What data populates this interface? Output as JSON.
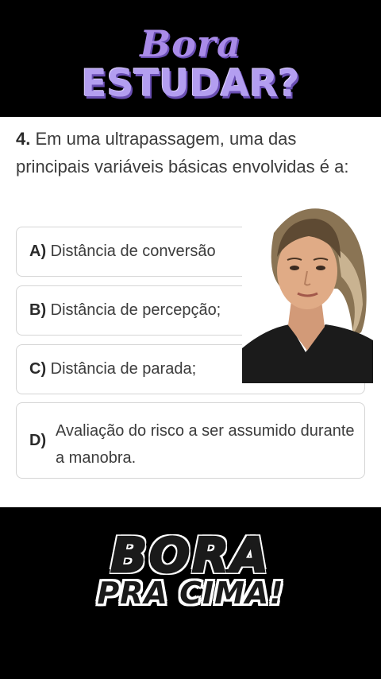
{
  "header": {
    "logo_line1": "Bora",
    "logo_line2": "ESTUDAR?"
  },
  "question": {
    "number": "4.",
    "text": "Em uma ultrapassagem, uma das principais variáveis básicas envolvidas é a:"
  },
  "options": [
    {
      "letter": "A)",
      "text": "Distância de conversão"
    },
    {
      "letter": "B)",
      "text": "Distância de percepção;"
    },
    {
      "letter": "C)",
      "text": "Distância de parada;"
    },
    {
      "letter": "D)",
      "text": "Avaliação do risco a ser assumido durante a manobra."
    }
  ],
  "footer": {
    "logo_line1": "BORA",
    "logo_line2": "PRA CIMA!"
  },
  "colors": {
    "background": "#000000",
    "content": "#ffffff",
    "logo_purple": "#a98be8",
    "text": "#3c3c3c",
    "border": "#d5d5d5"
  }
}
